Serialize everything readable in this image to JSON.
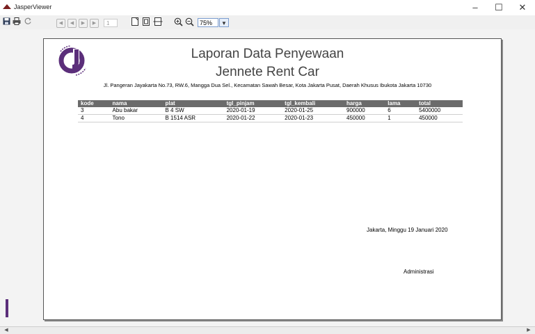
{
  "window": {
    "title": "JasperViewer",
    "minimize": "–",
    "maximize": "☐",
    "close": "✕"
  },
  "toolbar": {
    "page_number": "1",
    "zoom_value": "75%",
    "icons": [
      "save-icon",
      "print-icon",
      "reload-icon",
      "first-page-icon",
      "prev-page-icon",
      "next-page-icon",
      "last-page-icon",
      "actual-size-icon",
      "fit-page-icon",
      "fit-width-icon",
      "zoom-in-icon",
      "zoom-out-icon",
      "zoom-dropdown-icon"
    ]
  },
  "report": {
    "title": "Laporan Data Penyewaan",
    "subtitle": "Jennete Rent Car",
    "address": "Jl. Pangeran Jayakarta No.73, RW.6, Mangga Dua Sel., Kecamatan Sawah Besar, Kota Jakarta Pusat, Daerah Khusus Ibukota Jakarta 10730",
    "columns": [
      "kode",
      "nama",
      "plat",
      "tgl_pinjam",
      "tgl_kembali",
      "harga",
      "lama",
      "total"
    ],
    "rows": [
      [
        "3",
        "Abu bakar",
        "B 4 SW",
        "2020-01-19",
        "2020-01-25",
        "900000",
        "6",
        "5400000"
      ],
      [
        "4",
        "Tono",
        "B 1514 ASR",
        "2020-01-22",
        "2020-01-23",
        "450000",
        "1",
        "450000"
      ]
    ],
    "sign_date": "Jakarta,  Minggu 19 Januari 2020",
    "sign_role": "Administrasi"
  },
  "colors": {
    "brand_purple": "#5b2e7a",
    "header_gray": "#6b6b6b"
  }
}
